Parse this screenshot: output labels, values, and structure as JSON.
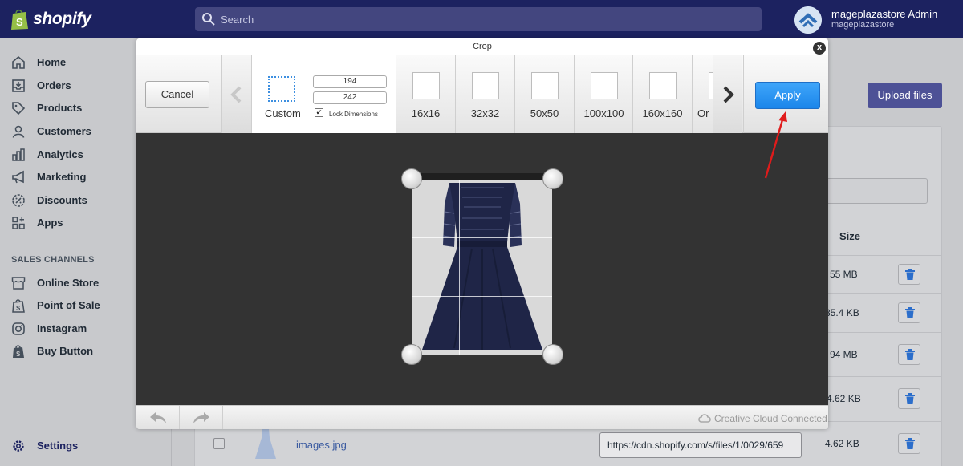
{
  "app": {
    "brand": "shopify",
    "search_placeholder": "Search",
    "user_name": "mageplazastore Admin",
    "user_store": "mageplazastore"
  },
  "sidebar": {
    "items": [
      {
        "label": "Home",
        "icon": "home-icon"
      },
      {
        "label": "Orders",
        "icon": "orders-icon"
      },
      {
        "label": "Products",
        "icon": "tag-icon"
      },
      {
        "label": "Customers",
        "icon": "person-icon"
      },
      {
        "label": "Analytics",
        "icon": "bar-chart-icon"
      },
      {
        "label": "Marketing",
        "icon": "megaphone-icon"
      },
      {
        "label": "Discounts",
        "icon": "discount-icon"
      },
      {
        "label": "Apps",
        "icon": "apps-icon"
      }
    ],
    "sales_channels_heading": "SALES CHANNELS",
    "channels": [
      {
        "label": "Online Store",
        "icon": "store-icon"
      },
      {
        "label": "Point of Sale",
        "icon": "pos-bag-icon"
      },
      {
        "label": "Instagram",
        "icon": "instagram-icon"
      },
      {
        "label": "Buy Button",
        "icon": "buy-button-icon"
      }
    ],
    "settings_label": "Settings"
  },
  "files_page": {
    "upload_button": "Upload files",
    "size_header": "Size",
    "sizes": [
      "55 MB",
      "35.4 KB",
      "94 MB",
      "4.62 KB"
    ],
    "last_row": {
      "filename": "images.jpg",
      "url": "https://cdn.shopify.com/s/files/1/0029/659",
      "size": "4.62 KB"
    }
  },
  "crop_modal": {
    "title": "Crop",
    "close": "x",
    "cancel": "Cancel",
    "apply": "Apply",
    "custom_label": "Custom",
    "width_value": "194",
    "height_value": "242",
    "lock_label": "Lock Dimensions",
    "lock_checked": true,
    "presets": [
      "16x16",
      "32x32",
      "50x50",
      "100x100",
      "160x160",
      "Or"
    ],
    "footer_status": "Creative Cloud Connected"
  },
  "colors": {
    "topbar": "#1c2260",
    "apply_blue": "#1b86ea",
    "annotation_arrow": "#e01b1b",
    "dress": "#1f2547"
  }
}
